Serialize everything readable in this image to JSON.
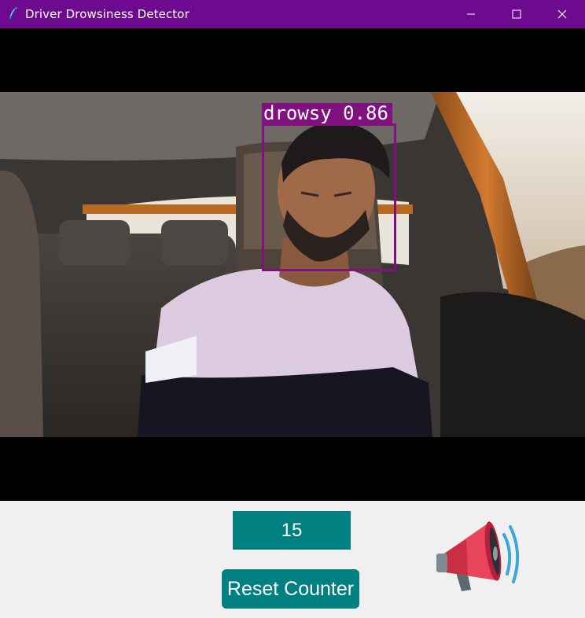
{
  "window": {
    "title": "Driver Drowsiness Detector",
    "title_bar_color": "#6d0a8f"
  },
  "window_controls": {
    "minimize_icon": "minimize-icon",
    "maximize_icon": "maximize-icon",
    "close_icon": "close-icon"
  },
  "detection": {
    "label": "drowsy",
    "confidence": "0.86",
    "label_text": "drowsy 0.86",
    "box_color": "#80117e"
  },
  "counter": {
    "value": "15",
    "color": "#008080"
  },
  "reset_button": {
    "label": "Reset Counter",
    "color": "#008080"
  },
  "alert_icon": "megaphone-icon"
}
